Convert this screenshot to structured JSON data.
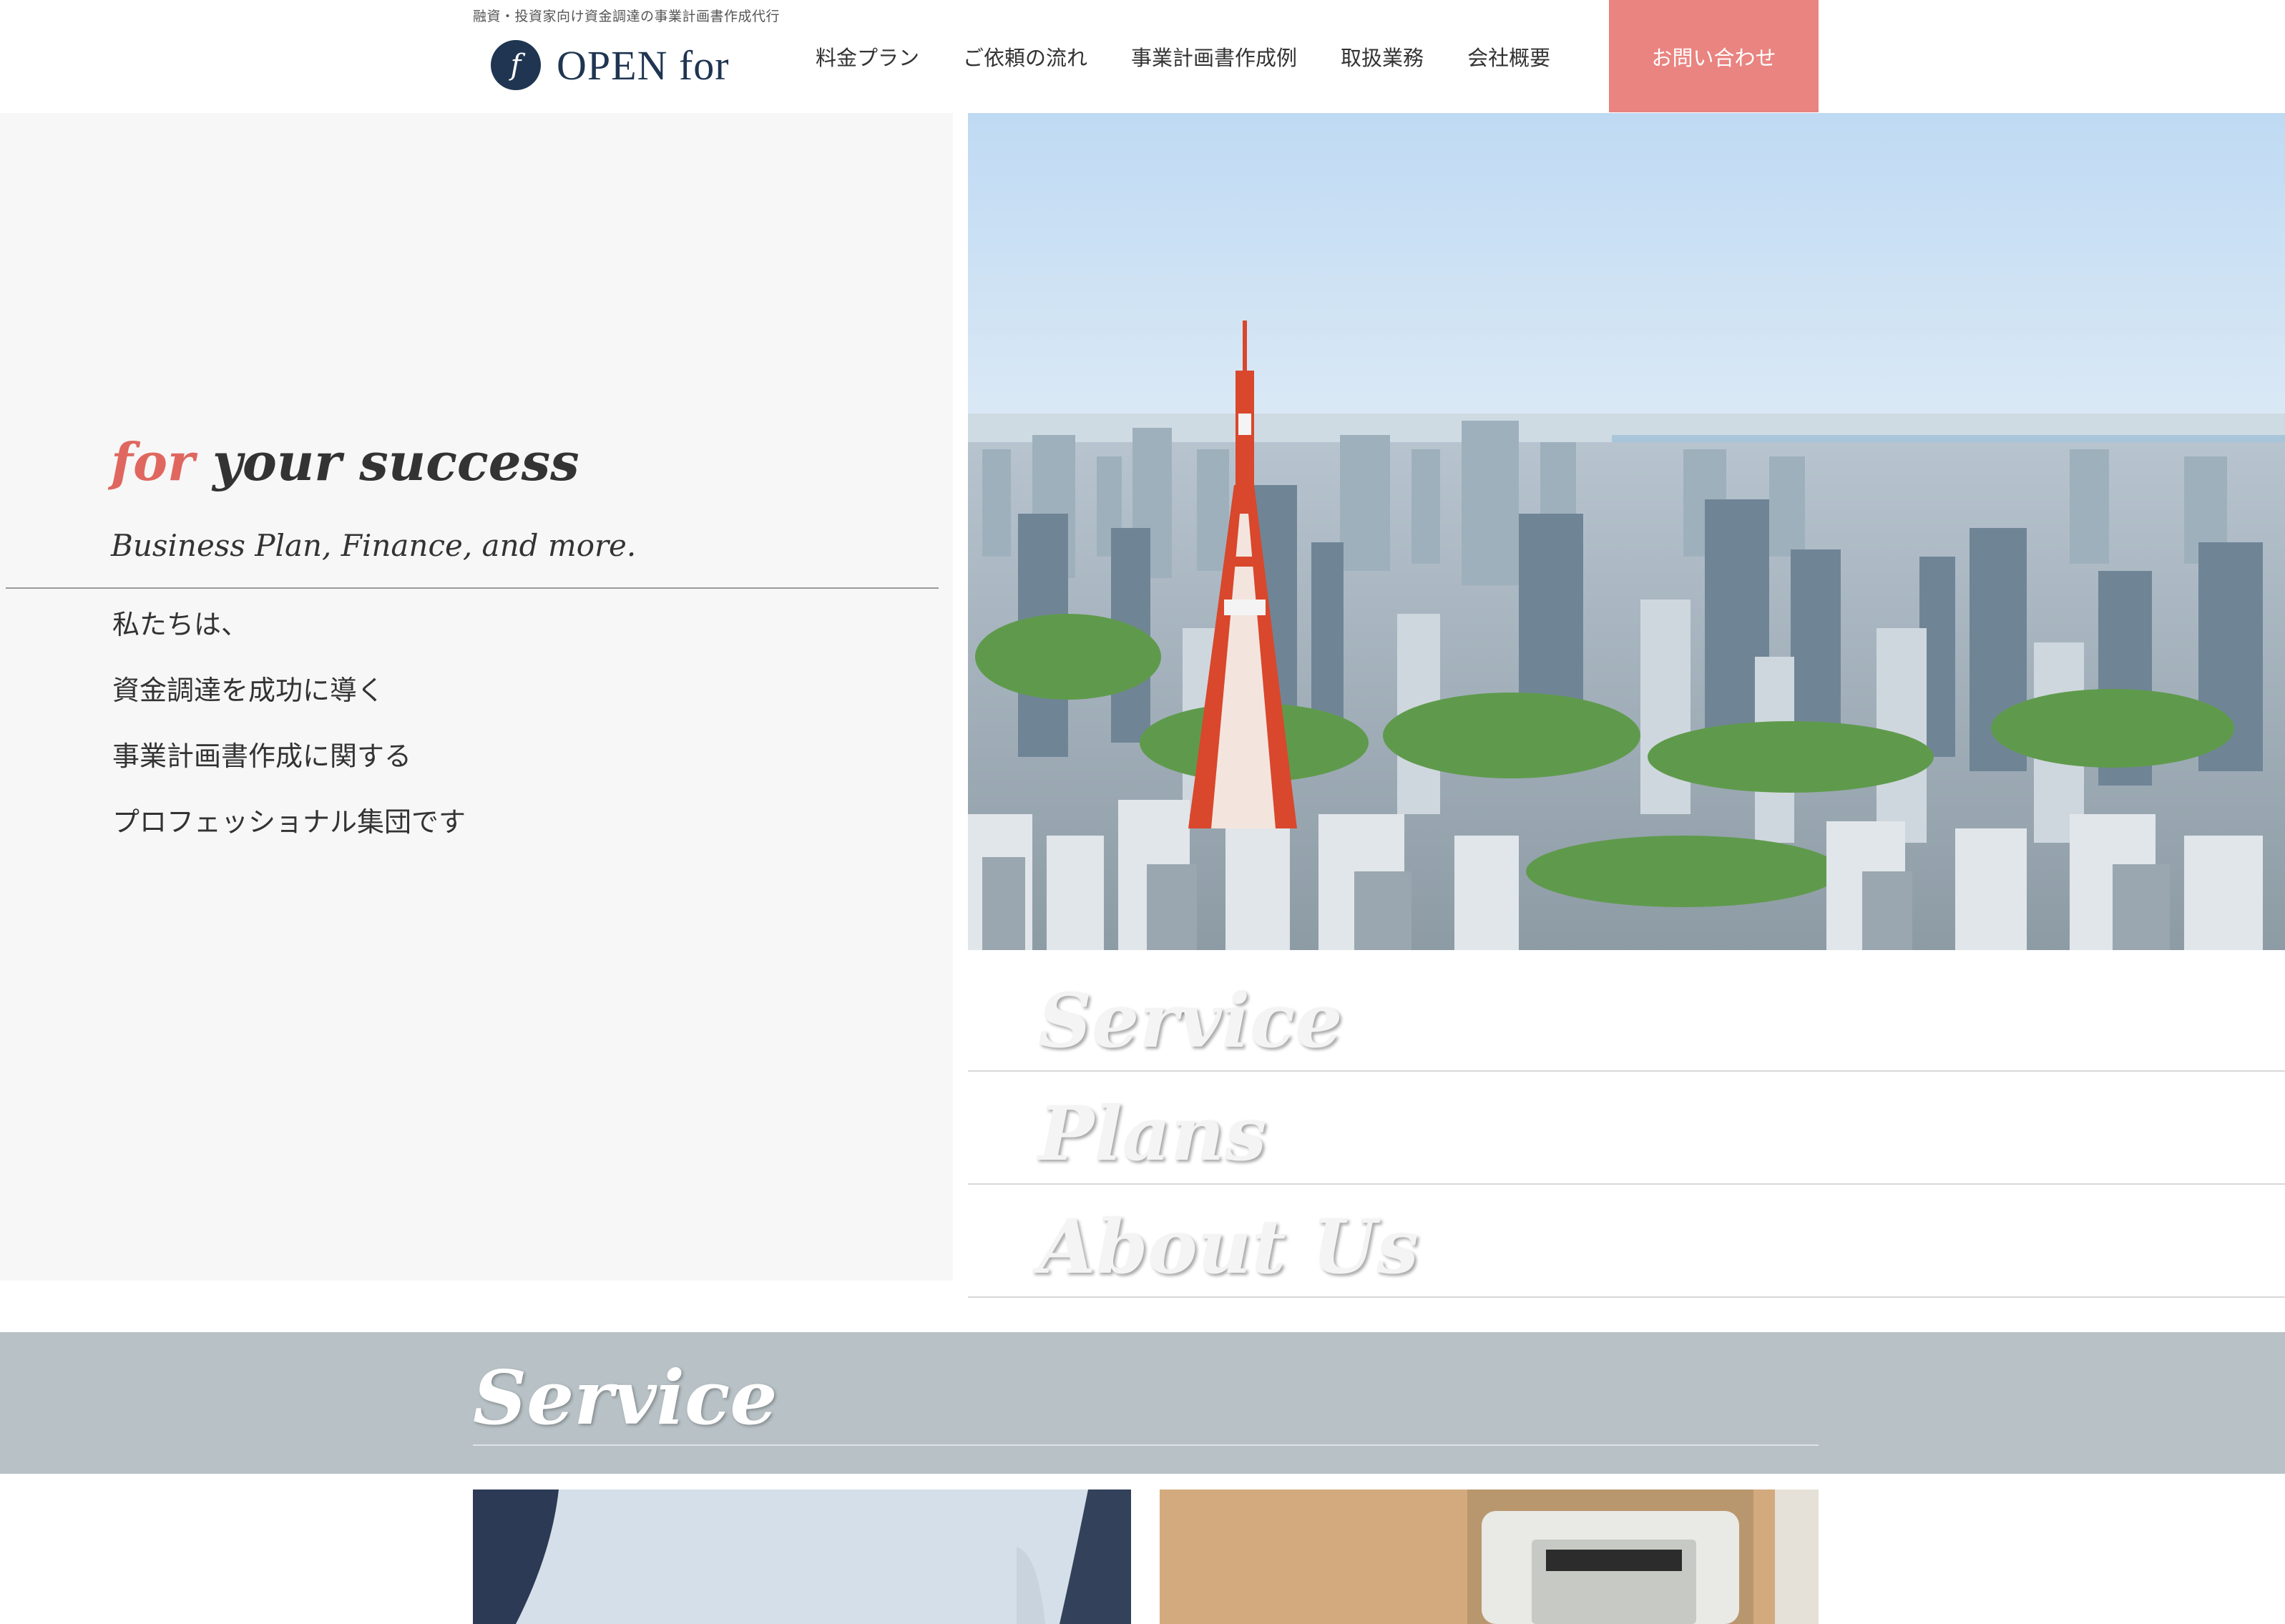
{
  "header": {
    "tagline": "融資・投資家向け資金調達の事業計画書作成代行",
    "logo_mark": "f",
    "logo_text": "OPEN for",
    "nav": [
      {
        "label": "料金プラン"
      },
      {
        "label": "ご依頼の流れ"
      },
      {
        "label": "事業計画書作成例"
      },
      {
        "label": "取扱業務"
      },
      {
        "label": "会社概要"
      }
    ],
    "cta_label": "お問い合わせ"
  },
  "hero": {
    "title_accent": "for",
    "title_rest": " your success",
    "subtitle": "Business Plan, Finance, and more.",
    "lines": [
      "私たちは、",
      "資金調達を成功に導く",
      "事業計画書作成に関する",
      "プロフェッショナル集団です"
    ]
  },
  "side_menu": [
    {
      "label": "Service"
    },
    {
      "label": "Plans"
    },
    {
      "label": "About Us"
    }
  ],
  "service_section": {
    "title": "Service"
  },
  "colors": {
    "brand_navy": "#1f3551",
    "accent_coral": "#e98480",
    "accent_text": "#e0675f",
    "band_gray": "#b8c2c6",
    "hero_bg": "#f7f7f7"
  },
  "icons": {
    "logo": "circle-f-logo-icon"
  }
}
